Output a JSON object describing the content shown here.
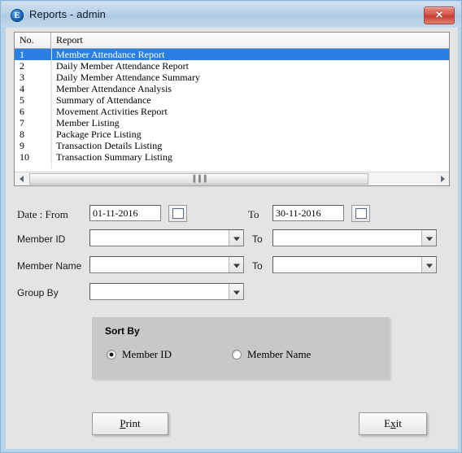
{
  "window": {
    "title": "Reports - admin",
    "app_icon": "E",
    "close_label": "✕"
  },
  "report_list": {
    "columns": [
      "No.",
      "Report"
    ],
    "selected_index": 0,
    "rows": [
      {
        "no": "1",
        "report": "Member Attendance Report"
      },
      {
        "no": "2",
        "report": "Daily Member Attendance Report"
      },
      {
        "no": "3",
        "report": "Daily Member Attendance Summary"
      },
      {
        "no": "4",
        "report": "Member Attendance Analysis"
      },
      {
        "no": "5",
        "report": "Summary of Attendance"
      },
      {
        "no": "6",
        "report": "Movement Activities Report"
      },
      {
        "no": "7",
        "report": "Member Listing"
      },
      {
        "no": "8",
        "report": "Package Price Listing"
      },
      {
        "no": "9",
        "report": "Transaction Details Listing"
      },
      {
        "no": "10",
        "report": "Transaction Summary Listing"
      }
    ],
    "scrollbar_grip": "▐▐▐"
  },
  "form": {
    "date_label": "Date : From",
    "date_from_value": "01-11-2016",
    "date_to_label": "To",
    "date_to_value": "30-11-2016",
    "member_id_label": "Member ID",
    "member_id_from_value": "",
    "member_id_to_label": "To",
    "member_id_to_value": "",
    "member_name_label": "Member Name",
    "member_name_from_value": "",
    "member_name_to_label": "To",
    "member_name_to_value": "",
    "group_by_label": "Group By",
    "group_by_value": ""
  },
  "sort_by": {
    "title": "Sort By",
    "option_member_id": "Member ID",
    "option_member_name": "Member Name",
    "selected": "Member ID"
  },
  "buttons": {
    "print_accel": "P",
    "print_rest": "rint",
    "exit_prefix": "E",
    "exit_accel": "x",
    "exit_rest": "it"
  },
  "colors": {
    "selection_blue": "#2a7fe0",
    "title_bar": "#b9d2e8",
    "close_red": "#d9564a",
    "panel_gray": "#c8c8c8",
    "client_gray": "#e4e4e4"
  }
}
